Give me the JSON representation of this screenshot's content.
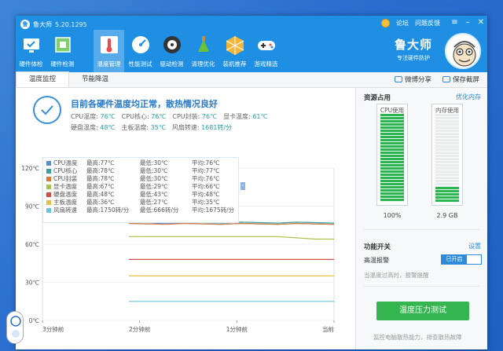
{
  "app": {
    "name": "鲁大师",
    "version": "5.20.1295",
    "slogan": "专注硬件防护"
  },
  "toolbar": [
    {
      "label": "硬件体检",
      "icon": "monitor-check-icon"
    },
    {
      "label": "硬件检测",
      "icon": "chip-icon"
    },
    {
      "label": "温度管理",
      "icon": "thermometer-icon",
      "active": true
    },
    {
      "label": "性能测试",
      "icon": "gauge-icon"
    },
    {
      "label": "驱动检测",
      "icon": "driver-icon"
    },
    {
      "label": "清理优化",
      "icon": "broom-icon"
    },
    {
      "label": "装机推荐",
      "icon": "cube-icon"
    },
    {
      "label": "游戏精选",
      "icon": "gamepad-icon"
    }
  ],
  "top_links": {
    "forum": "论坛",
    "feedback": "问题反馈"
  },
  "subtabs": {
    "temp_monitor": "温度监控",
    "power_save": "节能降温"
  },
  "share": {
    "weibo": "微博分享",
    "screenshot": "保存截屏"
  },
  "status": {
    "title": "目前各硬件温度均正常，散热情况良好",
    "row1": [
      {
        "label": "CPU温度:",
        "value": "76℃"
      },
      {
        "label": "CPU核心:",
        "value": "76℃"
      },
      {
        "label": "CPU封装:",
        "value": "76℃"
      },
      {
        "label": "显卡温度:",
        "value": "61℃"
      }
    ],
    "row2": [
      {
        "label": "硬盘温度:",
        "value": "48℃"
      },
      {
        "label": "主板温度:",
        "value": "35℃"
      },
      {
        "label": "风扇转速:",
        "value": "1681转/分"
      }
    ]
  },
  "legend": [
    {
      "name": "CPU温度",
      "max": "最高:77℃",
      "min": "最低:30℃",
      "avg": "平均:76℃",
      "color": "#5a8fc9"
    },
    {
      "name": "CPU核心",
      "max": "最高:78℃",
      "min": "最低:30℃",
      "avg": "平均:77℃",
      "color": "#3aa0a0"
    },
    {
      "name": "CPU封装",
      "max": "最高:78℃",
      "min": "最低:30℃",
      "avg": "平均:76℃",
      "color": "#d97a3a"
    },
    {
      "name": "显卡温度",
      "max": "最高:67℃",
      "min": "最低:29℃",
      "avg": "平均:66℃",
      "color": "#a8c24a"
    },
    {
      "name": "硬盘温度",
      "max": "最高:48℃",
      "min": "最低:43℃",
      "avg": "平均:48℃",
      "color": "#d04e4e"
    },
    {
      "name": "主板温度",
      "max": "最高:36℃",
      "min": "最低:27℃",
      "avg": "平均:35℃",
      "color": "#e3c24a"
    },
    {
      "name": "风扇转速",
      "max": "最高:1750转/分",
      "min": "最低:666转/分",
      "avg": "平均:1675转/分",
      "color": "#6cc3e0"
    }
  ],
  "chart_data": {
    "type": "line",
    "ylim": [
      0,
      120
    ],
    "yticks": [
      "0℃",
      "30℃",
      "60℃",
      "90℃",
      "120℃"
    ],
    "xticks": [
      "3分钟前",
      "2分钟前",
      "1分钟前",
      "当前"
    ],
    "series": [
      {
        "name": "CPU温度",
        "values": [
          76,
          76,
          77,
          76,
          76,
          76,
          76,
          76,
          76,
          76,
          76,
          76
        ]
      },
      {
        "name": "CPU核心",
        "values": [
          77,
          77,
          78,
          77,
          77,
          77,
          77,
          77,
          77,
          77,
          77,
          77
        ]
      },
      {
        "name": "CPU封装",
        "values": [
          76,
          76,
          76,
          76,
          76,
          76,
          76,
          76,
          76,
          76,
          76,
          76
        ]
      },
      {
        "name": "显卡温度",
        "values": [
          66,
          66,
          66,
          66,
          66,
          66,
          66,
          66,
          66,
          65,
          64,
          64
        ]
      },
      {
        "name": "硬盘温度",
        "values": [
          48,
          48,
          48,
          48,
          48,
          48,
          48,
          48,
          48,
          48,
          48,
          48
        ]
      },
      {
        "name": "主板温度",
        "values": [
          35,
          35,
          35,
          35,
          35,
          35,
          35,
          35,
          35,
          35,
          35,
          35
        ]
      },
      {
        "name": "风扇转速",
        "values": [
          15,
          15,
          15,
          15,
          15,
          15,
          15,
          15,
          15,
          15,
          15,
          15
        ]
      }
    ]
  },
  "resources": {
    "title": "资源占用",
    "link": "优化内存",
    "cpu": {
      "label": "CPU使用",
      "value": "100%",
      "fraction": 1.0
    },
    "mem": {
      "label": "内存使用",
      "value": "2.9 GB",
      "fraction": 0.17
    }
  },
  "features": {
    "title": "功能开关",
    "link": "设置",
    "alarm_label": "高温报警",
    "alarm_state": "已开启",
    "hint": "当温度过高时，报警提醒"
  },
  "stress_button": "温度压力测试",
  "footer_hint": "监控电脑散热能力，排查散热故障"
}
